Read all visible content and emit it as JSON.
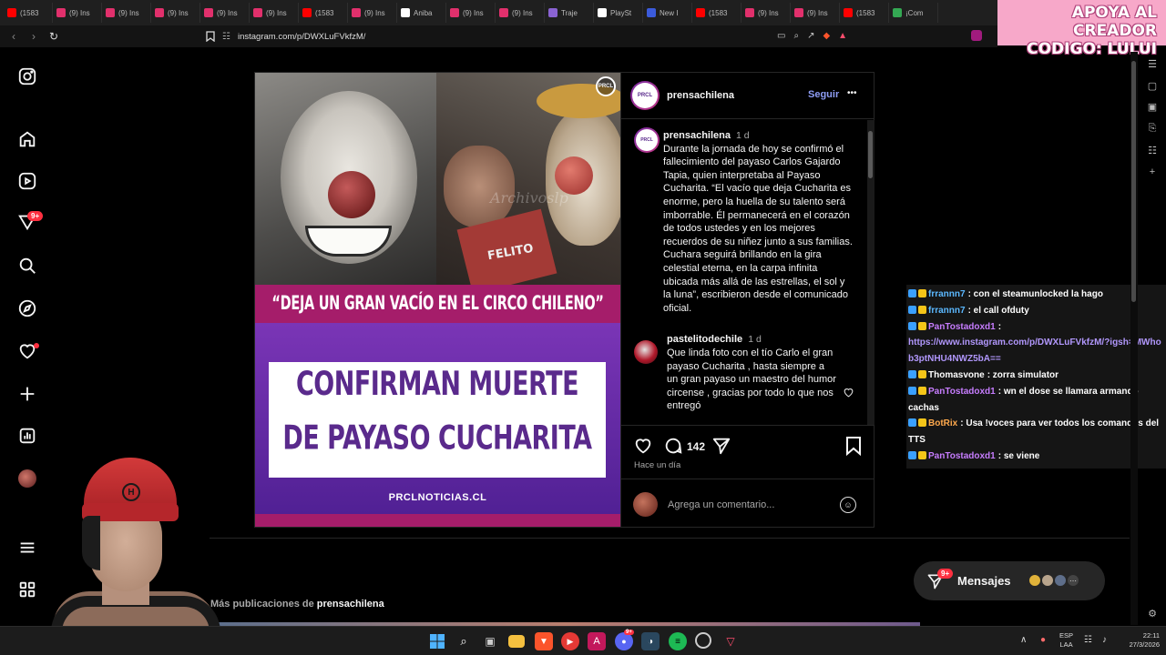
{
  "tabs": [
    {
      "label": "(1583",
      "color": "#ff0000"
    },
    {
      "label": "(9) Ins",
      "color": "#e1306c"
    },
    {
      "label": "(9) Ins",
      "color": "#e1306c"
    },
    {
      "label": "(9) Ins",
      "color": "#e1306c"
    },
    {
      "label": "(9) Ins",
      "color": "#e1306c"
    },
    {
      "label": "(9) Ins",
      "color": "#e1306c"
    },
    {
      "label": "(1583",
      "color": "#ff0000"
    },
    {
      "label": "(9) Ins",
      "color": "#e1306c"
    },
    {
      "label": "Aniba",
      "color": "#ffffff"
    },
    {
      "label": "(9) Ins",
      "color": "#e1306c"
    },
    {
      "label": "(9) Ins",
      "color": "#e1306c"
    },
    {
      "label": "Traje",
      "color": "#8a63d2"
    },
    {
      "label": "PlaySt",
      "color": "#ffffff"
    },
    {
      "label": "New I",
      "color": "#3b5bdb"
    },
    {
      "label": "(1583",
      "color": "#ff0000"
    },
    {
      "label": "(9) Ins",
      "color": "#e1306c"
    },
    {
      "label": "(9) Ins",
      "color": "#e1306c"
    },
    {
      "label": "(1583",
      "color": "#ff0000"
    },
    {
      "label": "¡Com",
      "color": "#34a853"
    }
  ],
  "promo": {
    "line1": "APOYA AL CREADOR",
    "line2": "CODIGO: LULUI"
  },
  "address": {
    "url": "instagram.com/p/DWXLuFVkfzM/"
  },
  "nav": {
    "notifications_badge": "9+"
  },
  "post": {
    "image_top_watermark": "Archivoslp",
    "image_brand": "PRCL",
    "quote": "“DEJA UN GRAN VACÍO EN EL CIRCO CHILENO”",
    "headline_line1": "CONFIRMAN MUERTE",
    "headline_line2": "DE PAYASO CUCHARITA",
    "site": "PRCLNOTICIAS.CL",
    "shirt_text": "FELITO",
    "author": "prensachilena",
    "follow_label": "Seguir",
    "more_label": "•••",
    "caption_time": "1 d",
    "caption": "Durante la jornada de hoy se confirmó el fallecimiento del payaso Carlos Gajardo Tapia, quien interpretaba al Payaso Cucharita. “El vacío que deja Cucharita es enorme, pero la huella de su talento será imborrable. Él permanecerá en el corazón de todos ustedes y en los mejores recuerdos de su niñez junto a sus familias. Cuchara seguirá brillando en la gira celestial eterna, en la carpa infinita ubicada más allá de las estrellas, el sol y la luna”, escribieron desde el comunicado oficial.",
    "comment_user": "pastelitodechile",
    "comment_time": "1 d",
    "comment_text": "Que linda foto con el tío Carlo el gran payaso Cucharita , hasta siempre a un gran payaso un maestro del humor circense , gracias por todo lo que nos entregó",
    "comment_count": "142",
    "time_ago": "Hace un día",
    "add_comment_placeholder": "Agrega un comentario..."
  },
  "more_posts": {
    "label": "Más publicaciones de ",
    "author": "prensachilena"
  },
  "messages": {
    "label": "Mensajes",
    "badge": "9+"
  },
  "chat": [
    {
      "user": "frrannn7",
      "msg": ": con el steamunlocked la hago",
      "color": "#5bb8ff"
    },
    {
      "user": "frrannn7",
      "msg": ": el call ofduty",
      "color": "#5bb8ff"
    },
    {
      "user": "PanTostadoxd1",
      "msg": ":",
      "color": "#c77dff",
      "link": "https://www.instagram.com/p/DWXLuFVkfzM/?igsh=MWhob3ptNHU4NWZ5bA=="
    },
    {
      "user": "Thomasvone",
      "msg": ": zorra simulator",
      "color": "#ffffff"
    },
    {
      "user": "PanTostadoxd1",
      "msg": ": wn el dose se llamara armando cachas",
      "color": "#c77dff"
    },
    {
      "user": "BotRix",
      "msg": ": Usa !voces para ver todos los comandos del TTS",
      "color": "#ffa94d"
    },
    {
      "user": "PanTostadoxd1",
      "msg": ": se viene",
      "color": "#c77dff"
    }
  ],
  "taskbar": {
    "lang1": "ESP",
    "lang2": "LAA",
    "time": "22:11",
    "date": "27/3/2026",
    "discord_badge": "9+"
  }
}
